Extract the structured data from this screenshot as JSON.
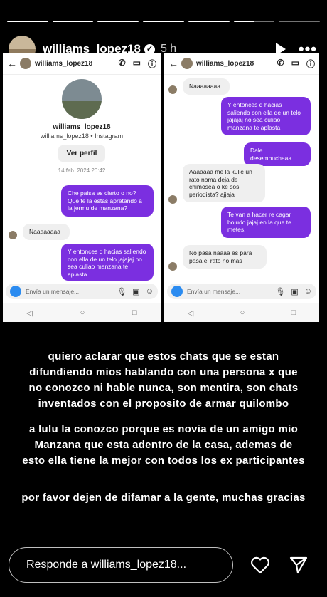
{
  "story": {
    "username": "williams_lopez18",
    "time": "5 h",
    "progress": [
      1,
      1,
      1,
      1,
      1,
      0.5,
      0
    ]
  },
  "left_shot": {
    "header_name": "williams_lopez18",
    "profile_name": "williams_lopez18",
    "profile_sub": "williams_lopez18 • Instagram",
    "view_profile": "Ver perfil",
    "date": "14 feb. 2024 20:42",
    "messages": [
      "Che paisa es cierto o no? Que te la estas apretando a la jermu de manzana?",
      "Naaaaaaaa",
      "Y entonces q hacias saliendo con ella de un telo jajajaj no sea culiao manzana te aplasta"
    ],
    "compose": "Envía un mensaje..."
  },
  "right_shot": {
    "header_name": "williams_lopez18",
    "messages": [
      "Naaaaaaaa",
      "Y entonces q hacias saliendo con ella de un telo jajajaj no sea culiao manzana te aplasta",
      "Dale desembuchaaa",
      "Aaaaaaa me la kulie un rato noma deja de chimosea o ke sos periodista? ajjaja",
      "Te van a hacer re cagar boludo jajaj en la que te metes.",
      "No pasa naaaa es para pasa el rato no más"
    ],
    "compose": "Envía un mensaje..."
  },
  "caption": {
    "p1": [
      "quiero aclarar que estos chats que se estan",
      "difundiendo mios hablando con una persona x que",
      "no conozco ni hable nunca, son mentira, son chats",
      "inventados con el proposito de armar quilombo"
    ],
    "p2": [
      "a lulu la conozco porque es novia de un amigo mio",
      "Manzana que esta adentro de la casa, ademas de",
      "esto ella tiene la mejor con todos los ex participantes"
    ],
    "p3": [
      "por favor dejen de difamar a la gente, muchas gracias"
    ]
  },
  "footer": {
    "reply_placeholder": "Responde a williams_lopez18..."
  }
}
